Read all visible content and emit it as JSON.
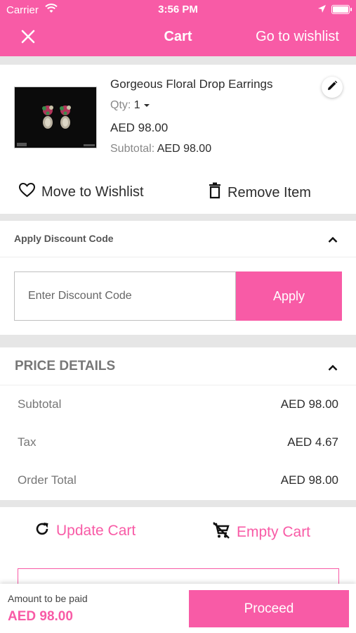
{
  "status_bar": {
    "carrier": "Carrier",
    "time": "3:56 PM"
  },
  "nav": {
    "title": "Cart",
    "wishlist_link": "Go to wishlist"
  },
  "colors": {
    "accent": "#f85ba6",
    "divider": "#e6e6e6"
  },
  "product": {
    "name": "Gorgeous Floral Drop Earrings",
    "qty_label": "Qty:",
    "qty_value": "1",
    "price": "AED 98.00",
    "subtotal_label": "Subtotal:",
    "subtotal_value": "AED 98.00",
    "move_to_wishlist": "Move to Wishlist",
    "remove_item": "Remove Item"
  },
  "discount": {
    "header": "Apply Discount Code",
    "placeholder": "Enter Discount Code",
    "apply_label": "Apply"
  },
  "price_details": {
    "header": "PRICE DETAILS",
    "rows": [
      {
        "label": "Subtotal",
        "value": "AED 98.00"
      },
      {
        "label": "Tax",
        "value": "AED 4.67"
      },
      {
        "label": "Order Total",
        "value": "AED 98.00"
      }
    ]
  },
  "cart_actions": {
    "update": "Update Cart",
    "empty": "Empty Cart"
  },
  "footer": {
    "amount_label": "Amount to be paid",
    "amount": "AED 98.00",
    "proceed": "Proceed"
  },
  "icons": {
    "close": "close-icon",
    "wifi": "wifi-icon",
    "location": "location-arrow-icon",
    "battery": "battery-icon",
    "edit": "pencil-icon",
    "heart": "heart-icon",
    "trash": "trash-icon",
    "chevron": "chevron-up-icon",
    "refresh": "refresh-icon",
    "empty_cart": "cart-remove-icon",
    "caret": "caret-down-icon"
  }
}
